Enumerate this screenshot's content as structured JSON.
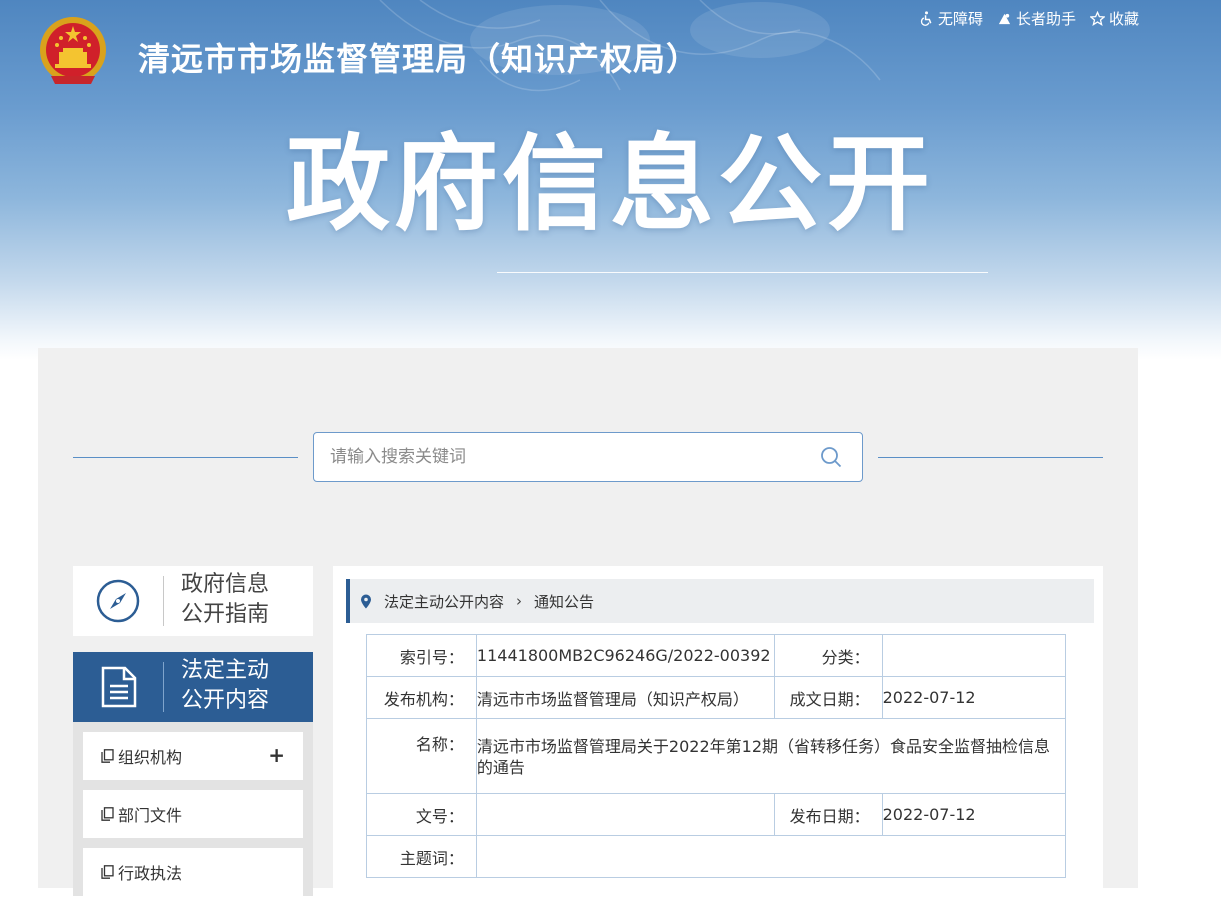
{
  "header": {
    "site_title": "清远市市场监督管理局（知识产权局）",
    "hero_title": "政府信息公开",
    "links": [
      {
        "label": "无障碍",
        "icon": "wheelchair-icon"
      },
      {
        "label": "长者助手",
        "icon": "elder-helper-icon"
      },
      {
        "label": "收藏",
        "icon": "star-icon"
      }
    ]
  },
  "search": {
    "placeholder": "请输入搜索关键词",
    "value": ""
  },
  "sidebar": {
    "cards": [
      {
        "line1": "政府信息",
        "line2": "公开指南",
        "icon": "compass-icon"
      },
      {
        "line1": "法定主动",
        "line2": "公开内容",
        "icon": "document-icon"
      }
    ],
    "items": [
      {
        "label": "组织机构",
        "expand": "+"
      },
      {
        "label": "部门文件"
      },
      {
        "label": "行政执法"
      }
    ]
  },
  "breadcrumb": {
    "items": [
      "法定主动公开内容",
      "通知公告"
    ]
  },
  "meta": {
    "index_label": "索引号：",
    "index_value": "11441800MB2C96246G/2022-00392",
    "category_label": "分类：",
    "category_value": "",
    "publisher_label": "发布机构：",
    "publisher_value": "清远市市场监督管理局（知识产权局）",
    "written_date_label": "成文日期：",
    "written_date_value": "2022-07-12",
    "name_label": "名称：",
    "name_value": "清远市市场监督管理局关于2022年第12期（省转移任务）食品安全监督抽检信息的通告",
    "doc_no_label": "文号：",
    "doc_no_value": "",
    "publish_date_label": "发布日期：",
    "publish_date_value": "2022-07-12",
    "keywords_label": "主题词：",
    "keywords_value": ""
  },
  "colors": {
    "primary": "#2c5d94",
    "banner_top": "#4f86c0",
    "border": "#b9cde2"
  }
}
